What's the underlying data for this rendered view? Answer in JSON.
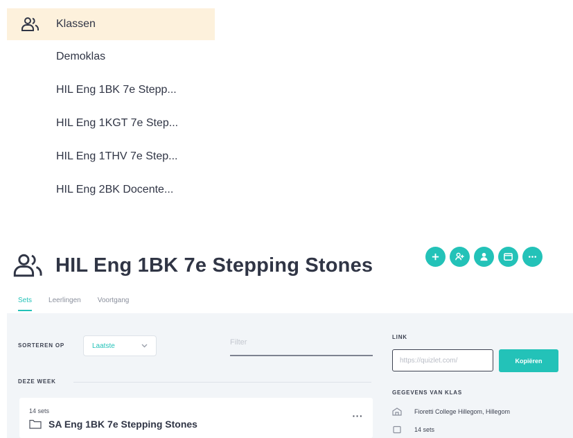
{
  "class_list": {
    "header_label": "Klassen",
    "header_icon": "users-icon",
    "items": [
      {
        "label": "Demoklas"
      },
      {
        "label": "HIL Eng 1BK 7e Stepp..."
      },
      {
        "label": "HIL Eng 1KGT 7e Step..."
      },
      {
        "label": "HIL Eng 1THV 7e Step..."
      },
      {
        "label": "HIL Eng 2BK Docente..."
      }
    ]
  },
  "class_page": {
    "title": "HIL Eng 1BK 7e Stepping Stones",
    "title_icon": "users-icon",
    "actions": [
      {
        "icon": "plus-icon"
      },
      {
        "icon": "add-user-icon"
      },
      {
        "icon": "person-icon"
      },
      {
        "icon": "folder-icon"
      },
      {
        "icon": "more-icon"
      }
    ],
    "accent_color": "#23c2b8",
    "tabs": [
      {
        "label": "Sets",
        "active": true
      },
      {
        "label": "Leerlingen",
        "active": false
      },
      {
        "label": "Voortgang",
        "active": false
      }
    ],
    "sort": {
      "label": "SORTEREN OP",
      "value": "Laatste"
    },
    "filter": {
      "placeholder": "Filter"
    },
    "section_label": "DEZE WEEK",
    "set_card": {
      "count": "14 sets",
      "title": "SA Eng 1BK 7e Stepping Stones",
      "menu": "···"
    },
    "link": {
      "label": "LINK",
      "value": "https://quizlet.com/",
      "copy_button": "Kopiëren"
    },
    "class_info": {
      "label": "GEGEVENS VAN KLAS",
      "school": "Fioretti College Hillegom, Hillegom",
      "sets": "14 sets"
    }
  }
}
